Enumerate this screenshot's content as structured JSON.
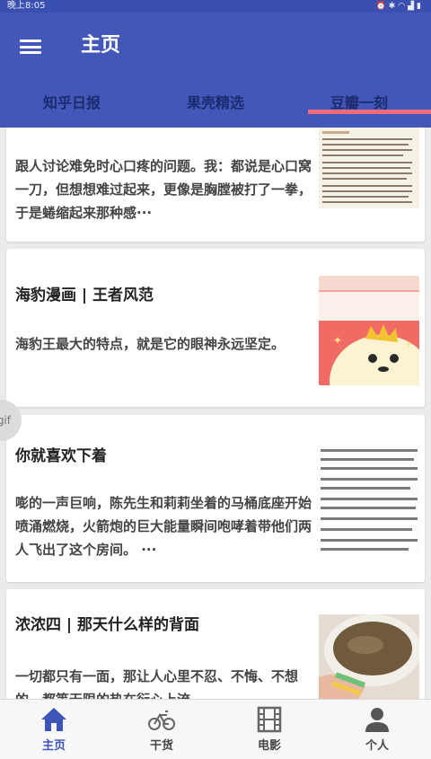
{
  "status_bar": {
    "time": "晚上8:05",
    "icons": [
      "alarm-icon",
      "bluetooth-icon",
      "wifi-icon",
      "signal-icon",
      "battery-icon"
    ]
  },
  "app_bar": {
    "title": "主页",
    "menu_icon": "hamburger-menu-icon",
    "background": "#4257b8"
  },
  "tabs": [
    {
      "label": "知乎日报",
      "active": false
    },
    {
      "label": "果壳精选",
      "active": false
    },
    {
      "label": "豆瓣一刻",
      "active": true
    }
  ],
  "accent_indicator": "#ee6b7c",
  "feed": {
    "items": [
      {
        "title": "",
        "summary": "跟人讨论难免时心口疼的问题。我：都说是心口窝一刀，但想想难过起来，更像是胸膛被打了一拳，于是蜷缩起来那种感···"
      },
      {
        "title": "海豹漫画 | 王者风范",
        "summary": "海豹王最大的特点，就是它的眼神永远坚定。"
      },
      {
        "title": "你就喜欢下着",
        "summary": "嘭的一声巨响，陈先生和莉莉坐着的马桶底座开始喷涌燃烧，火箭炮的巨大能量瞬间咆哮着带他们两人飞出了这个房间。 ···"
      },
      {
        "title": "浓浓四 | 那天什么样的背面",
        "summary": "一切都只有一面，那让人心里不忍、不悔、不想的，都等无限的热在衍心上流"
      }
    ],
    "gif_badge": "gif"
  },
  "bottom_nav": [
    {
      "label": "主页",
      "icon": "home-icon",
      "active": true
    },
    {
      "label": "干货",
      "icon": "bicycle-icon",
      "active": false
    },
    {
      "label": "电影",
      "icon": "film-icon",
      "active": false
    },
    {
      "label": "个人",
      "icon": "person-icon",
      "active": false
    }
  ],
  "colors": {
    "primary": "#4257b8",
    "tab_text": "#1c2a6e",
    "nav_active": "#3d54b8"
  }
}
